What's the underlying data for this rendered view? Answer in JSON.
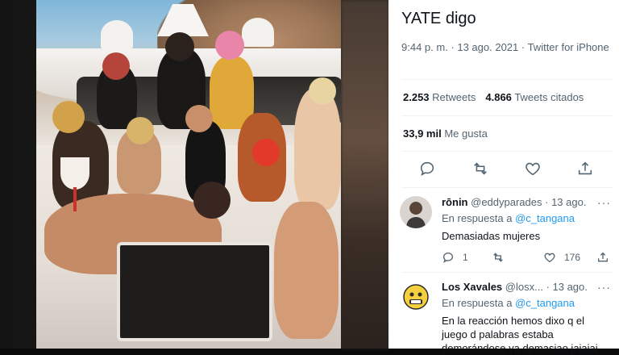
{
  "tweet": {
    "text": "YATE digo",
    "time": "9:44 p. m.",
    "date": "13 ago. 2021",
    "source": "Twitter for iPhone",
    "meta_line": "9:44 p. m. · 13 ago. 2021 · Twitter for iPhone",
    "retweets_count": "2.253",
    "retweets_label": "Retweets",
    "quotes_count": "4.866",
    "quotes_label": "Tweets citados",
    "likes_count": "33,9 mil",
    "likes_label": "Me gusta"
  },
  "actions": [
    {
      "icon": "reply-icon"
    },
    {
      "icon": "retweet-icon"
    },
    {
      "icon": "like-icon"
    },
    {
      "icon": "share-icon"
    }
  ],
  "replies": [
    {
      "name": "rōnin",
      "handle": "@eddyparades",
      "date": "· 13 ago.",
      "in_reply_label": "En respuesta a",
      "mention": "@c_tangana",
      "text": "Demasiadas mujeres",
      "reply_count": "1",
      "retweet_count": "",
      "like_count": "176"
    },
    {
      "name": "Los Xavales",
      "handle": "@losx...",
      "date": "· 13 ago.",
      "in_reply_label": "En respuesta a",
      "mention": "@c_tangana",
      "text": "En la reacción hemos dixo q el juego d palabras estaba demorándose ya demasiao jajajaj"
    }
  ],
  "more_label": "···",
  "colors": {
    "accent": "#1d9bf0",
    "text": "#0f1419",
    "muted": "#536471"
  }
}
